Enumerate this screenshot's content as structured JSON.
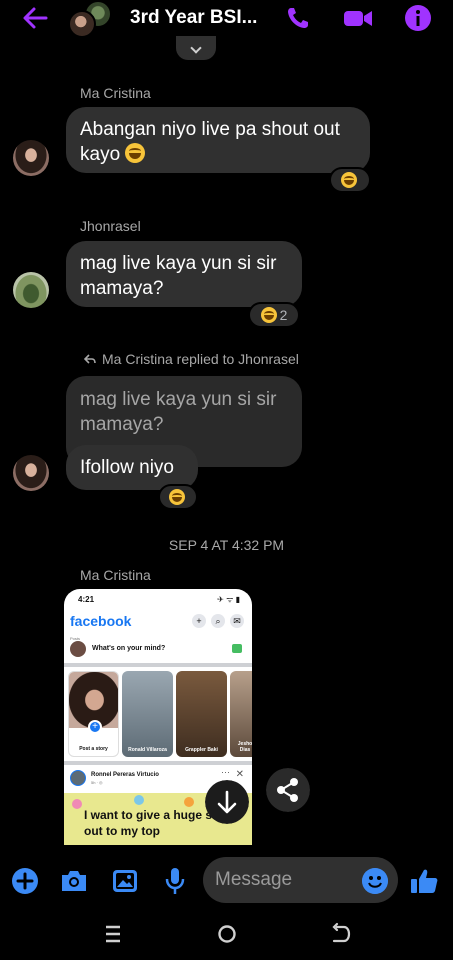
{
  "header": {
    "title": "3rd Year BSI...",
    "back_icon": "arrow-left-icon",
    "call_icon": "phone-icon",
    "video_icon": "video-camera-icon",
    "info_icon": "info-icon",
    "accent_color": "#a033ff"
  },
  "messages": [
    {
      "sender": "Ma Cristina",
      "text": "Abangan niyo live pa shout out kayo",
      "emoji": "grinning-squint-emoji",
      "reactions": {
        "emoji": "grinning-squint-emoji",
        "count": ""
      }
    },
    {
      "sender": "Jhonrasel",
      "text": "mag live kaya yun si sir mamaya?",
      "reactions": {
        "emoji": "grinning-squint-emoji",
        "count": "2"
      }
    },
    {
      "reply_label": "Ma Cristina replied to Jhonrasel",
      "quoted_text": "mag live kaya yun si sir mamaya?",
      "text": "Ifollow niyo",
      "reactions": {
        "emoji": "grinning-squint-emoji",
        "count": ""
      }
    }
  ],
  "date_divider": "SEP 4 AT 4:32 PM",
  "image_message": {
    "sender": "Ma Cristina",
    "shot": {
      "time": "4:21",
      "status_icons": "✈ ᯤ ▮",
      "brand": "facebook",
      "mind_small": "Posts",
      "mind_prompt": "What's on your mind?",
      "stories": [
        {
          "caption": "Post a story"
        },
        {
          "caption": "Ronald Villaroza"
        },
        {
          "caption": "Grappler Baki"
        },
        {
          "caption": "Jesho Dias"
        }
      ],
      "post_author": "Ronnel Pereras Virtucio",
      "post_sub": "5h · ◎",
      "post_text": "I want to give a huge shout-out to my top"
    }
  },
  "composer": {
    "placeholder": "Message",
    "icons": [
      "plus-icon",
      "camera-icon",
      "gallery-icon",
      "microphone-icon",
      "emoji-icon",
      "thumbs-up-icon"
    ],
    "accent_color": "#3b8af5"
  },
  "system_nav": {
    "recents_icon": "recents-icon",
    "home_icon": "home-icon",
    "back_icon": "nav-back-icon"
  }
}
